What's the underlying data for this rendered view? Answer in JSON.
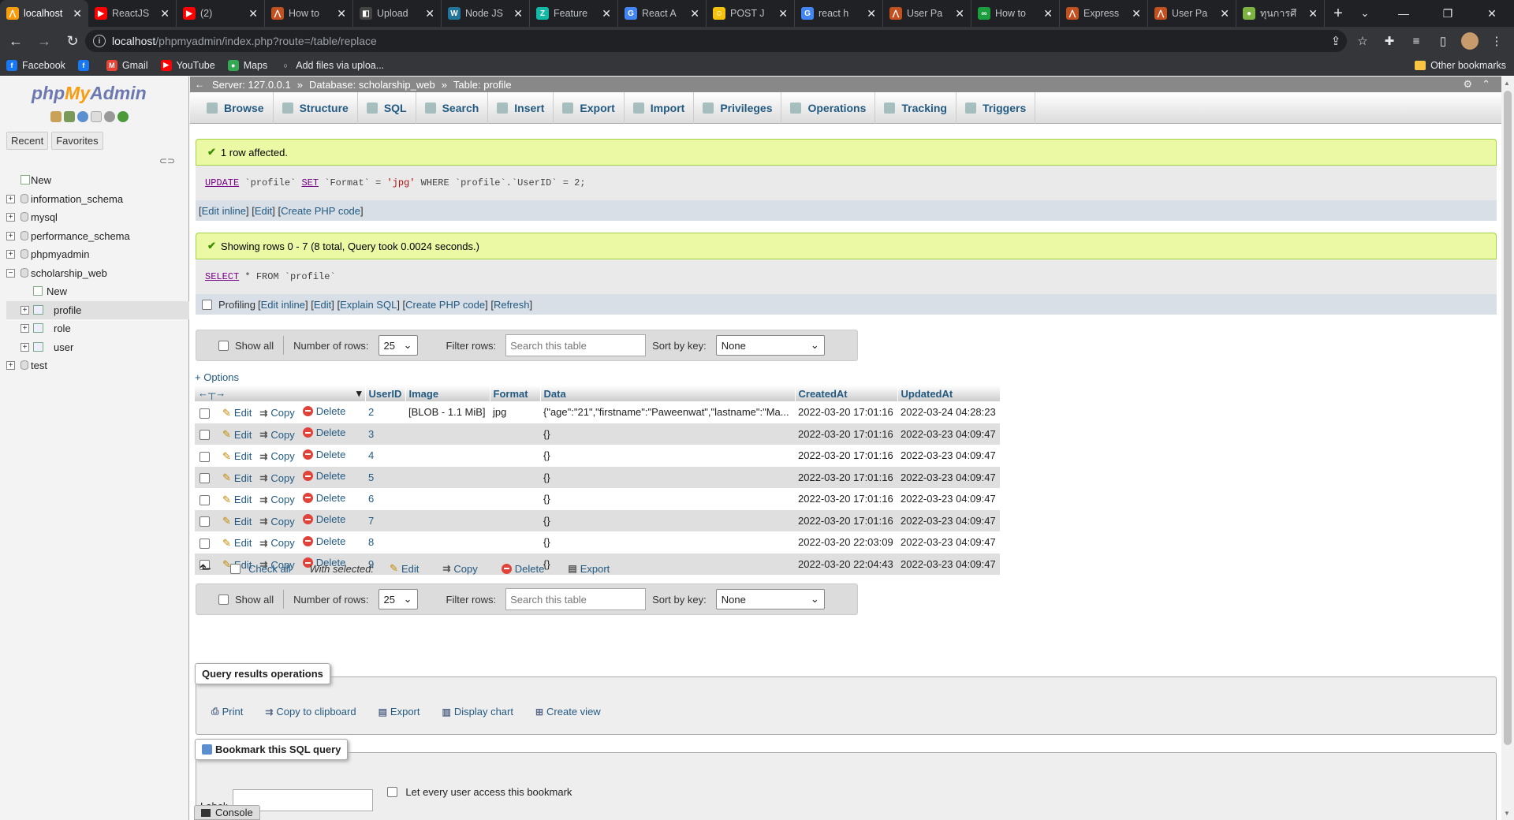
{
  "browser": {
    "tabs": [
      {
        "title": "localhost",
        "color": "#f89c0e",
        "glyph": "⋀",
        "active": true
      },
      {
        "title": "ReactJS",
        "color": "#ff0000",
        "glyph": "▶"
      },
      {
        "title": "(2)",
        "color": "#ff0000",
        "glyph": "▶"
      },
      {
        "title": "How to",
        "color": "#c5501f",
        "glyph": "⋀"
      },
      {
        "title": "Upload",
        "color": "#ffffff",
        "glyph": "◧"
      },
      {
        "title": "Node JS",
        "color": "#21759b",
        "glyph": "W"
      },
      {
        "title": "Feature",
        "color": "#14b8a6",
        "glyph": "Z"
      },
      {
        "title": "React A",
        "color": "#4285f4",
        "glyph": "G"
      },
      {
        "title": "POST J",
        "color": "#f4c20d",
        "glyph": "☺"
      },
      {
        "title": "react h",
        "color": "#4285f4",
        "glyph": "G"
      },
      {
        "title": "User Pa",
        "color": "#c5501f",
        "glyph": "⋀"
      },
      {
        "title": "How to",
        "color": "#1b9e3e",
        "glyph": "∞"
      },
      {
        "title": "Express",
        "color": "#c5501f",
        "glyph": "⋀"
      },
      {
        "title": "User Pa",
        "color": "#c5501f",
        "glyph": "⋀"
      },
      {
        "title": "ทุนการศึ",
        "color": "#7cb342",
        "glyph": "●"
      }
    ],
    "url_host": "localhost",
    "url_path": "/phpmyadmin/index.php?route=/table/replace",
    "bookmarks": [
      {
        "label": "Facebook",
        "color": "#1877f2",
        "glyph": "f"
      },
      {
        "label": "",
        "color": "#1877f2",
        "glyph": "f"
      },
      {
        "label": "Gmail",
        "color": "#ea4335",
        "glyph": "M"
      },
      {
        "label": "YouTube",
        "color": "#ff0000",
        "glyph": "▶"
      },
      {
        "label": "Maps",
        "color": "#34a853",
        "glyph": "●"
      },
      {
        "label": "Add files via uploa...",
        "color": "#e8eaed",
        "glyph": "○"
      }
    ],
    "other_bookmarks": "Other bookmarks"
  },
  "pma": {
    "logo_php": "php",
    "logo_my": "My",
    "logo_admin": "Admin",
    "nav_tabs": [
      "Recent",
      "Favorites"
    ],
    "tree": [
      {
        "label": "New",
        "level": 0,
        "type": "new"
      },
      {
        "label": "information_schema",
        "level": 0,
        "type": "db"
      },
      {
        "label": "mysql",
        "level": 0,
        "type": "db"
      },
      {
        "label": "performance_schema",
        "level": 0,
        "type": "db"
      },
      {
        "label": "phpmyadmin",
        "level": 0,
        "type": "db"
      },
      {
        "label": "scholarship_web",
        "level": 0,
        "type": "db-open"
      },
      {
        "label": "New",
        "level": 1,
        "type": "new"
      },
      {
        "label": "profile",
        "level": 1,
        "type": "table",
        "selected": true
      },
      {
        "label": "role",
        "level": 1,
        "type": "table"
      },
      {
        "label": "user",
        "level": 1,
        "type": "table"
      },
      {
        "label": "test",
        "level": 0,
        "type": "db"
      }
    ],
    "breadcrumb": {
      "server": "Server: 127.0.0.1",
      "database": "Database: scholarship_web",
      "table": "Table: profile"
    },
    "menu": [
      "Browse",
      "Structure",
      "SQL",
      "Search",
      "Insert",
      "Export",
      "Import",
      "Privileges",
      "Operations",
      "Tracking",
      "Triggers"
    ],
    "msg1": "1 row affected.",
    "sql1": {
      "kw1": "UPDATE",
      "p1": " `profile` ",
      "kw2": "SET",
      "p2": " `Format` = ",
      "s1": "'jpg'",
      "p3": " WHERE `profile`.`UserID` = 2;"
    },
    "links1": [
      "Edit inline",
      "Edit",
      "Create PHP code"
    ],
    "msg2": "Showing rows 0 - 7 (8 total, Query took 0.0024 seconds.)",
    "sql2": {
      "kw1": "SELECT",
      "p1": " * FROM `profile`"
    },
    "profiling": "Profiling",
    "links2": [
      "Edit inline",
      "Edit",
      "Explain SQL",
      "Create PHP code",
      "Refresh"
    ],
    "navbar": {
      "show_all": "Show all",
      "num_rows_label": "Number of rows:",
      "num_rows": "25",
      "filter_label": "Filter rows:",
      "filter_placeholder": "Search this table",
      "sort_label": "Sort by key:",
      "sort_value": "None"
    },
    "options": "+ Options",
    "columns": [
      "UserID",
      "Image",
      "Format",
      "Data",
      "CreatedAt",
      "UpdatedAt"
    ],
    "actions": {
      "edit": "Edit",
      "copy": "Copy",
      "delete": "Delete"
    },
    "rows": [
      {
        "UserID": "2",
        "Image": "[BLOB - 1.1 MiB]",
        "Format": "jpg",
        "Data": "{\"age\":\"21\",\"firstname\":\"Paweenwat\",\"lastname\":\"Ma...",
        "CreatedAt": "2022-03-20 17:01:16",
        "UpdatedAt": "2022-03-24 04:28:23"
      },
      {
        "UserID": "3",
        "Image": "",
        "Format": "",
        "Data": "{}",
        "CreatedAt": "2022-03-20 17:01:16",
        "UpdatedAt": "2022-03-23 04:09:47"
      },
      {
        "UserID": "4",
        "Image": "",
        "Format": "",
        "Data": "{}",
        "CreatedAt": "2022-03-20 17:01:16",
        "UpdatedAt": "2022-03-23 04:09:47"
      },
      {
        "UserID": "5",
        "Image": "",
        "Format": "",
        "Data": "{}",
        "CreatedAt": "2022-03-20 17:01:16",
        "UpdatedAt": "2022-03-23 04:09:47"
      },
      {
        "UserID": "6",
        "Image": "",
        "Format": "",
        "Data": "{}",
        "CreatedAt": "2022-03-20 17:01:16",
        "UpdatedAt": "2022-03-23 04:09:47"
      },
      {
        "UserID": "7",
        "Image": "",
        "Format": "",
        "Data": "{}",
        "CreatedAt": "2022-03-20 17:01:16",
        "UpdatedAt": "2022-03-23 04:09:47"
      },
      {
        "UserID": "8",
        "Image": "",
        "Format": "",
        "Data": "{}",
        "CreatedAt": "2022-03-20 22:03:09",
        "UpdatedAt": "2022-03-23 04:09:47"
      },
      {
        "UserID": "9",
        "Image": "",
        "Format": "",
        "Data": "{}",
        "CreatedAt": "2022-03-20 22:04:43",
        "UpdatedAt": "2022-03-23 04:09:47"
      }
    ],
    "bulk": {
      "check_all": "Check all",
      "with_selected": "With selected:",
      "edit": "Edit",
      "copy": "Copy",
      "delete": "Delete",
      "export": "Export"
    },
    "qro_title": "Query results operations",
    "qro": [
      "Print",
      "Copy to clipboard",
      "Export",
      "Display chart",
      "Create view"
    ],
    "bookmark_title": "Bookmark this SQL query",
    "label_label": "Label:",
    "let_every_user": "Let every user access this bookmark",
    "console": "Console"
  }
}
